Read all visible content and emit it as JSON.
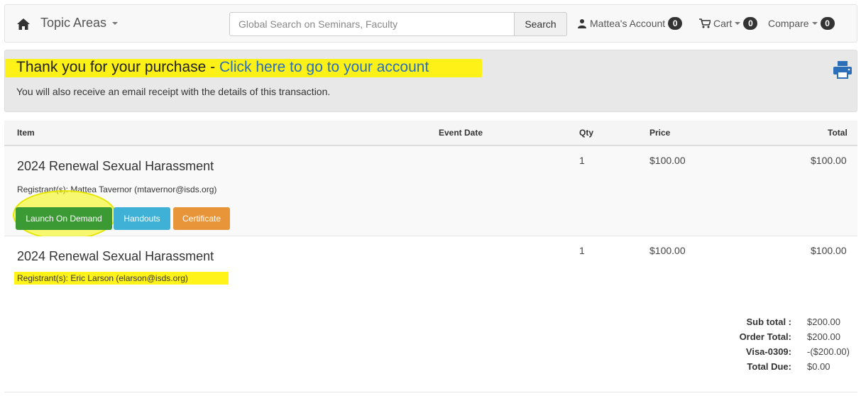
{
  "nav": {
    "topic_areas_label": "Topic Areas",
    "search_placeholder": "Global Search on Seminars, Faculty",
    "search_button_label": "Search",
    "account_label": "Mattea's Account",
    "account_badge": "0",
    "cart_label": "Cart",
    "cart_badge": "0",
    "compare_label": "Compare",
    "compare_badge": "0"
  },
  "alert": {
    "title_text": "Thank you for your purchase - ",
    "title_link": "Click here to go to your account",
    "subtitle": "You will also receive an email receipt with the details of this transaction."
  },
  "table": {
    "headers": {
      "item": "Item",
      "event_date": "Event Date",
      "qty": "Qty",
      "price": "Price",
      "total": "Total"
    },
    "rows": [
      {
        "title": "2024 Renewal Sexual Harassment",
        "registrant": "Registrant(s): Mattea Tavernor (mtavernor@isds.org)",
        "qty": "1",
        "price": "$100.00",
        "total": "$100.00",
        "buttons": {
          "launch": "Launch On Demand",
          "handouts": "Handouts",
          "certificate": "Certificate"
        }
      },
      {
        "title": "2024 Renewal Sexual Harassment",
        "registrant": "Registrant(s): Eric Larson (elarson@isds.org)",
        "qty": "1",
        "price": "$100.00",
        "total": "$100.00"
      }
    ]
  },
  "totals": {
    "subtotal_label": "Sub total :",
    "subtotal_value": "$200.00",
    "order_total_label": "Order Total:",
    "order_total_value": "$200.00",
    "payment_label": "Visa-0309:",
    "payment_value": "-($200.00)",
    "total_due_label": "Total Due:",
    "total_due_value": "$0.00"
  },
  "colors": {
    "link": "#2a6fb8",
    "highlight": "#fff200",
    "launch_button": "#3c9a35",
    "handouts_button": "#3fb0d6",
    "certificate_button": "#e8953a",
    "print_icon": "#2a6fb8"
  },
  "icons": {
    "home": "home-icon",
    "user": "user-icon",
    "cart": "cart-icon",
    "print": "print-icon"
  }
}
